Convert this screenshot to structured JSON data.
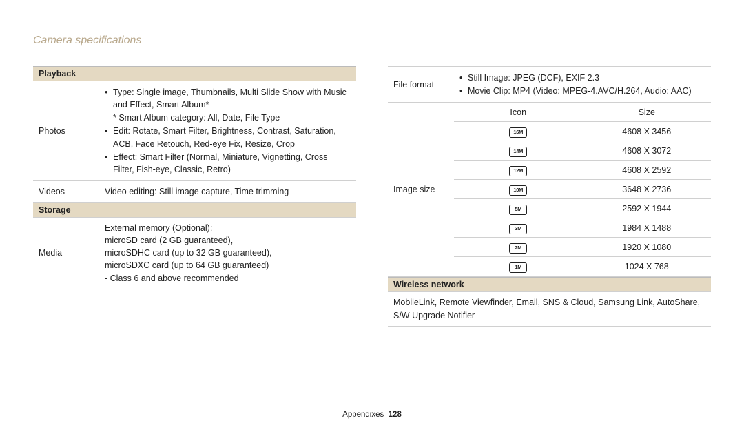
{
  "title": "Camera specifications",
  "footer": {
    "label": "Appendixes",
    "page": "128"
  },
  "left": {
    "playback_header": "Playback",
    "photos_label": "Photos",
    "photos": {
      "type": "Type: Single image, Thumbnails, Multi Slide Show with Music and Effect, Smart Album*",
      "smart_album": "* Smart Album category: All, Date, File Type",
      "edit": "Edit: Rotate, Smart Filter, Brightness, Contrast, Saturation, ACB, Face Retouch, Red-eye Fix, Resize, Crop",
      "effect": "Effect: Smart Filter (Normal, Miniature, Vignetting, Cross Filter, Fish-eye, Classic, Retro)"
    },
    "videos_label": "Videos",
    "videos_value": "Video editing: Still image capture, Time trimming",
    "storage_header": "Storage",
    "media_label": "Media",
    "media": {
      "l1": "External memory (Optional):",
      "l2": "microSD card (2 GB guaranteed),",
      "l3": "microSDHC card (up to 32 GB guaranteed),",
      "l4": "microSDXC card (up to 64 GB guaranteed)",
      "l5": "- Class 6 and above recommended"
    }
  },
  "right": {
    "fileformat_label": "File format",
    "fileformat": {
      "still": "Still Image: JPEG (DCF), EXIF 2.3",
      "movie": "Movie Clip: MP4 (Video: MPEG-4.AVC/H.264, Audio: AAC)"
    },
    "imagesize_label": "Image size",
    "sizes_header": {
      "icon": "Icon",
      "size": "Size"
    },
    "sizes": [
      {
        "icon": "16M",
        "size": "4608 X 3456"
      },
      {
        "icon": "14M",
        "size": "4608 X 3072"
      },
      {
        "icon": "12M",
        "size": "4608 X 2592"
      },
      {
        "icon": "10M",
        "size": "3648 X 2736"
      },
      {
        "icon": "5M",
        "size": "2592 X 1944"
      },
      {
        "icon": "3M",
        "size": "1984 X 1488"
      },
      {
        "icon": "2M",
        "size": "1920 X 1080"
      },
      {
        "icon": "1M",
        "size": "1024 X 768"
      }
    ],
    "wireless_header": "Wireless network",
    "wireless_body": "MobileLink, Remote Viewfinder, Email, SNS & Cloud, Samsung Link, AutoShare, S/W Upgrade Notifier"
  }
}
